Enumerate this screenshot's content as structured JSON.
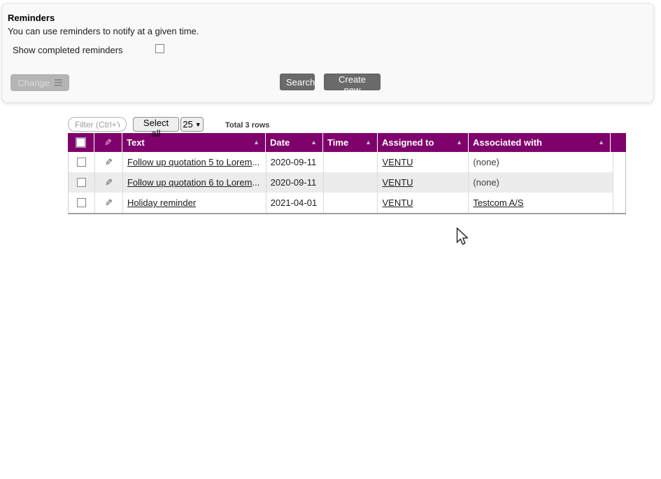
{
  "panel": {
    "title": "Reminders",
    "subtitle": "You can use reminders to notify at a given time.",
    "show_completed_label": "Show completed reminders",
    "change_label": "Change",
    "search_label": "Search",
    "create_label": "Create new"
  },
  "toolbar": {
    "filter_placeholder": "Filter (Ctrl+Y)",
    "select_all_label": "Select all",
    "page_size": "25",
    "total_label": "Total 3 rows"
  },
  "table": {
    "columns": [
      "Text",
      "Date",
      "Time",
      "Assigned to",
      "Associated with"
    ],
    "sort_state": "ascending-on-all",
    "rows": [
      {
        "text": "Follow up quotation 5 to Lorem",
        "truncated": true,
        "date": "2020-09-11",
        "time": "",
        "assigned_to": "VENTU",
        "associated_with": "(none)"
      },
      {
        "text": "Follow up quotation 6 to Lorem",
        "truncated": true,
        "date": "2020-09-11",
        "time": "",
        "assigned_to": "VENTU",
        "associated_with": "(none)"
      },
      {
        "text": "Holiday reminder",
        "truncated": false,
        "date": "2021-04-01",
        "time": "",
        "assigned_to": "VENTU",
        "associated_with": "Testcom A/S"
      }
    ],
    "truncation_indicator": "..."
  },
  "icons": {
    "pencil": "✎",
    "sort_asc": "▲",
    "dropdown_caret": "▼"
  },
  "colors": {
    "header_bg": "#7f016c",
    "row_alt_bg": "#ececec",
    "dark_button_bg": "#6a6a6a",
    "disabled_button_bg": "#b5b5b5",
    "panel_bg": "#f9f9f9"
  }
}
